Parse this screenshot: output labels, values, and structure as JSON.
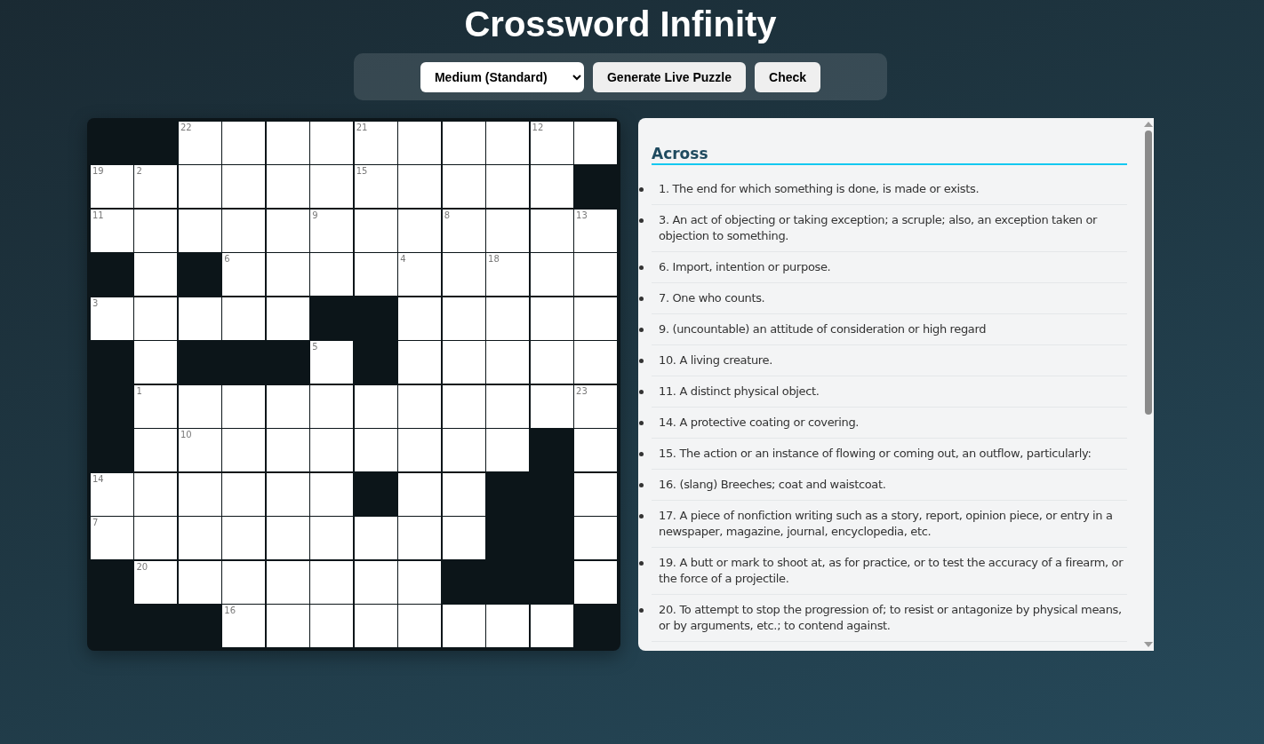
{
  "title": "Crossword Infinity",
  "toolbar": {
    "difficulty": "Medium (Standard)",
    "buttons": [
      "Generate Live Puzzle",
      "Check"
    ]
  },
  "grid": {
    "rows": [
      [
        {
          "blocked": true
        },
        {
          "blocked": true
        },
        {
          "blocked": false,
          "number": "22"
        },
        {
          "blocked": false
        },
        {
          "blocked": false
        },
        {
          "blocked": false
        },
        {
          "blocked": false,
          "number": "21"
        },
        {
          "blocked": false
        },
        {
          "blocked": false
        },
        {
          "blocked": false
        },
        {
          "blocked": false,
          "number": "12"
        },
        {
          "blocked": false
        }
      ],
      [
        {
          "blocked": false,
          "number": "19"
        },
        {
          "blocked": false,
          "number": "2"
        },
        {
          "blocked": false
        },
        {
          "blocked": false
        },
        {
          "blocked": false
        },
        {
          "blocked": false
        },
        {
          "blocked": false,
          "number": "15"
        },
        {
          "blocked": false
        },
        {
          "blocked": false
        },
        {
          "blocked": false
        },
        {
          "blocked": false
        },
        {
          "blocked": true
        }
      ],
      [
        {
          "blocked": false,
          "number": "11"
        },
        {
          "blocked": false
        },
        {
          "blocked": false
        },
        {
          "blocked": false
        },
        {
          "blocked": false
        },
        {
          "blocked": false,
          "number": "9"
        },
        {
          "blocked": false
        },
        {
          "blocked": false
        },
        {
          "blocked": false,
          "number": "8"
        },
        {
          "blocked": false
        },
        {
          "blocked": false
        },
        {
          "blocked": false,
          "number": "13"
        }
      ],
      [
        {
          "blocked": true
        },
        {
          "blocked": false
        },
        {
          "blocked": true
        },
        {
          "blocked": false,
          "number": "6"
        },
        {
          "blocked": false
        },
        {
          "blocked": false
        },
        {
          "blocked": false
        },
        {
          "blocked": false,
          "number": "4"
        },
        {
          "blocked": false
        },
        {
          "blocked": false,
          "number": "18"
        },
        {
          "blocked": false
        },
        {
          "blocked": false
        }
      ],
      [
        {
          "blocked": false,
          "number": "3"
        },
        {
          "blocked": false
        },
        {
          "blocked": false
        },
        {
          "blocked": false
        },
        {
          "blocked": false
        },
        {
          "blocked": true
        },
        {
          "blocked": true
        },
        {
          "blocked": false
        },
        {
          "blocked": false
        },
        {
          "blocked": false
        },
        {
          "blocked": false
        },
        {
          "blocked": false
        }
      ],
      [
        {
          "blocked": true
        },
        {
          "blocked": false
        },
        {
          "blocked": true
        },
        {
          "blocked": true
        },
        {
          "blocked": true
        },
        {
          "blocked": false,
          "number": "5"
        },
        {
          "blocked": true
        },
        {
          "blocked": false
        },
        {
          "blocked": false
        },
        {
          "blocked": false
        },
        {
          "blocked": false
        },
        {
          "blocked": false
        }
      ],
      [
        {
          "blocked": true
        },
        {
          "blocked": false,
          "number": "1"
        },
        {
          "blocked": false
        },
        {
          "blocked": false
        },
        {
          "blocked": false
        },
        {
          "blocked": false
        },
        {
          "blocked": false
        },
        {
          "blocked": false
        },
        {
          "blocked": false
        },
        {
          "blocked": false
        },
        {
          "blocked": false
        },
        {
          "blocked": false,
          "number": "23"
        }
      ],
      [
        {
          "blocked": true
        },
        {
          "blocked": false
        },
        {
          "blocked": false,
          "number": "10"
        },
        {
          "blocked": false
        },
        {
          "blocked": false
        },
        {
          "blocked": false
        },
        {
          "blocked": false
        },
        {
          "blocked": false
        },
        {
          "blocked": false
        },
        {
          "blocked": false
        },
        {
          "blocked": true
        },
        {
          "blocked": false
        }
      ],
      [
        {
          "blocked": false,
          "number": "14"
        },
        {
          "blocked": false
        },
        {
          "blocked": false
        },
        {
          "blocked": false
        },
        {
          "blocked": false
        },
        {
          "blocked": false
        },
        {
          "blocked": true
        },
        {
          "blocked": false
        },
        {
          "blocked": false
        },
        {
          "blocked": true
        },
        {
          "blocked": true
        },
        {
          "blocked": false
        }
      ],
      [
        {
          "blocked": false,
          "number": "7"
        },
        {
          "blocked": false
        },
        {
          "blocked": false
        },
        {
          "blocked": false
        },
        {
          "blocked": false
        },
        {
          "blocked": false
        },
        {
          "blocked": false
        },
        {
          "blocked": false
        },
        {
          "blocked": false
        },
        {
          "blocked": true
        },
        {
          "blocked": true
        },
        {
          "blocked": false
        }
      ],
      [
        {
          "blocked": true
        },
        {
          "blocked": false,
          "number": "20"
        },
        {
          "blocked": false
        },
        {
          "blocked": false
        },
        {
          "blocked": false
        },
        {
          "blocked": false
        },
        {
          "blocked": false
        },
        {
          "blocked": false
        },
        {
          "blocked": true
        },
        {
          "blocked": true
        },
        {
          "blocked": true
        },
        {
          "blocked": false
        }
      ],
      [
        {
          "blocked": true
        },
        {
          "blocked": true
        },
        {
          "blocked": true
        },
        {
          "blocked": false,
          "number": "16"
        },
        {
          "blocked": false
        },
        {
          "blocked": false
        },
        {
          "blocked": false
        },
        {
          "blocked": false
        },
        {
          "blocked": false
        },
        {
          "blocked": false
        },
        {
          "blocked": false
        },
        {
          "blocked": true
        }
      ]
    ]
  },
  "clues": {
    "heading": "Across",
    "items": [
      "1. The end for which something is done, is made or exists.",
      "3. An act of objecting or taking exception; a scruple; also, an exception taken or objection to something.",
      "6. Import, intention or purpose.",
      "7. One who counts.",
      "9. (uncountable) an attitude of consideration or high regard",
      "10. A living creature.",
      "11. A distinct physical object.",
      "14. A protective coating or covering.",
      "15. The action or an instance of flowing or coming out, an outflow, particularly:",
      "16. (slang) Breeches; coat and waistcoat.",
      "17. A piece of nonfiction writing such as a story, report, opinion piece, or entry in a newspaper, magazine, journal, encyclopedia, etc.",
      "19. A butt or mark to shoot at, as for practice, or to test the accuracy of a firearm, or the force of a projectile.",
      "20. To attempt to stop the progression of; to resist or antagonize by physical means, or by arguments, etc.; to contend against."
    ]
  }
}
